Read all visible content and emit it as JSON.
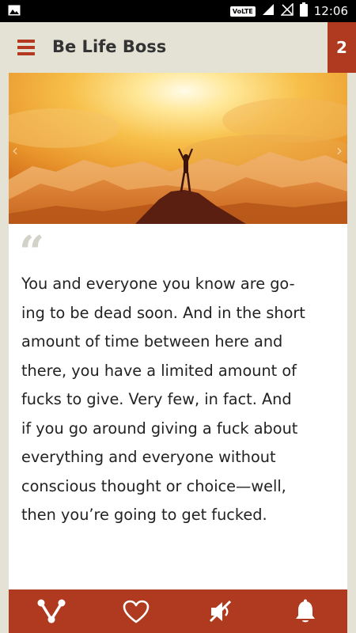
{
  "status_bar": {
    "network_badge": "VoLTE",
    "time": "12:06",
    "icons": [
      "image-notification-icon",
      "signal-icon",
      "no-sim-icon",
      "battery-icon"
    ]
  },
  "app_bar": {
    "title": "Be Life Boss",
    "counter": "2",
    "menu_icon": "hamburger-menu-icon"
  },
  "hero": {
    "description_icon": "mountain-summit-image"
  },
  "quote": {
    "mark": "“",
    "lines": [
      "You and everyone you know are go-",
      "ing to be dead soon. And in the short",
      "amount of time between here and",
      "there, you have a limited amount of",
      "fucks to give. Very few, in fact. And",
      "if you go around giving a fuck about",
      "everything and everyone without",
      "conscious thought or choice—well,",
      "then you’re going to get fucked."
    ]
  },
  "bottom_bar": {
    "buttons": [
      "share-icon",
      "heart-icon",
      "mute-icon",
      "bell-icon"
    ]
  },
  "colors": {
    "accent": "#b03a1f",
    "background": "#e3e2d5",
    "card": "#ffffff",
    "text": "#222222"
  }
}
